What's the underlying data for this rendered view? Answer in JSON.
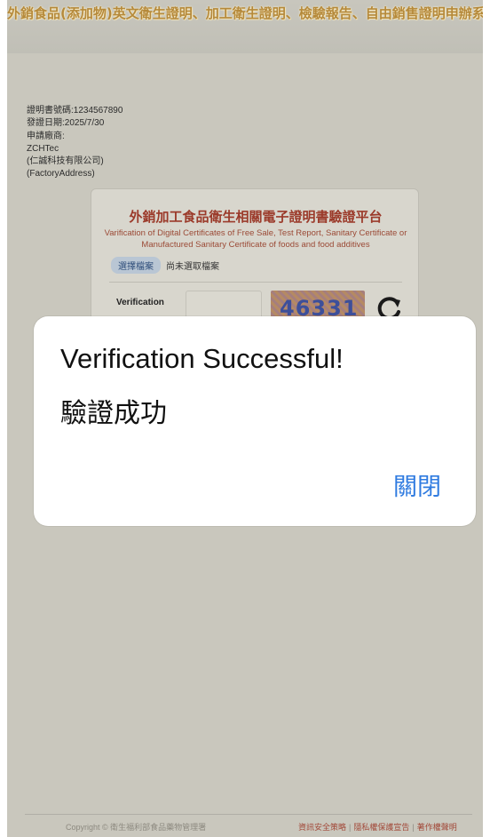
{
  "banner": {
    "title": "外銷食品(添加物)英文衛生證明、加工衛生證明、檢驗報告、自由銷售證明申辦系統"
  },
  "certificate_info": {
    "cert_no": "證明書號碼:1234567890",
    "issue_date": "發證日期:2025/7/30",
    "applicant_label": "申請廠商:",
    "company_en": "ZCHTec",
    "company_zh": "(仁誠科技有限公司)",
    "factory_address": "(FactoryAddress)"
  },
  "platform": {
    "title": "外銷加工食品衛生相關電子證明書驗證平台",
    "subtitle": "Varification of Digital Certificates of Free Sale, Test Report, Sanitary Certificate or Manufactured Sanitary Certificate of foods and food additives",
    "choose_file_label": "選擇檔案",
    "no_file_text": "尚未選取檔案",
    "verification_label": "Verification",
    "captcha_text": "46331"
  },
  "footer": {
    "copyright": "Copyright © 衛生福利部食品藥物管理署",
    "links": [
      "資訊安全策略",
      "隱私權保護宣告",
      "著作權聲明"
    ]
  },
  "dialog": {
    "message_en": "Verification Successful!",
    "message_zh": "驗證成功",
    "close_label": "關閉",
    "close_color": "#2f7be0"
  }
}
